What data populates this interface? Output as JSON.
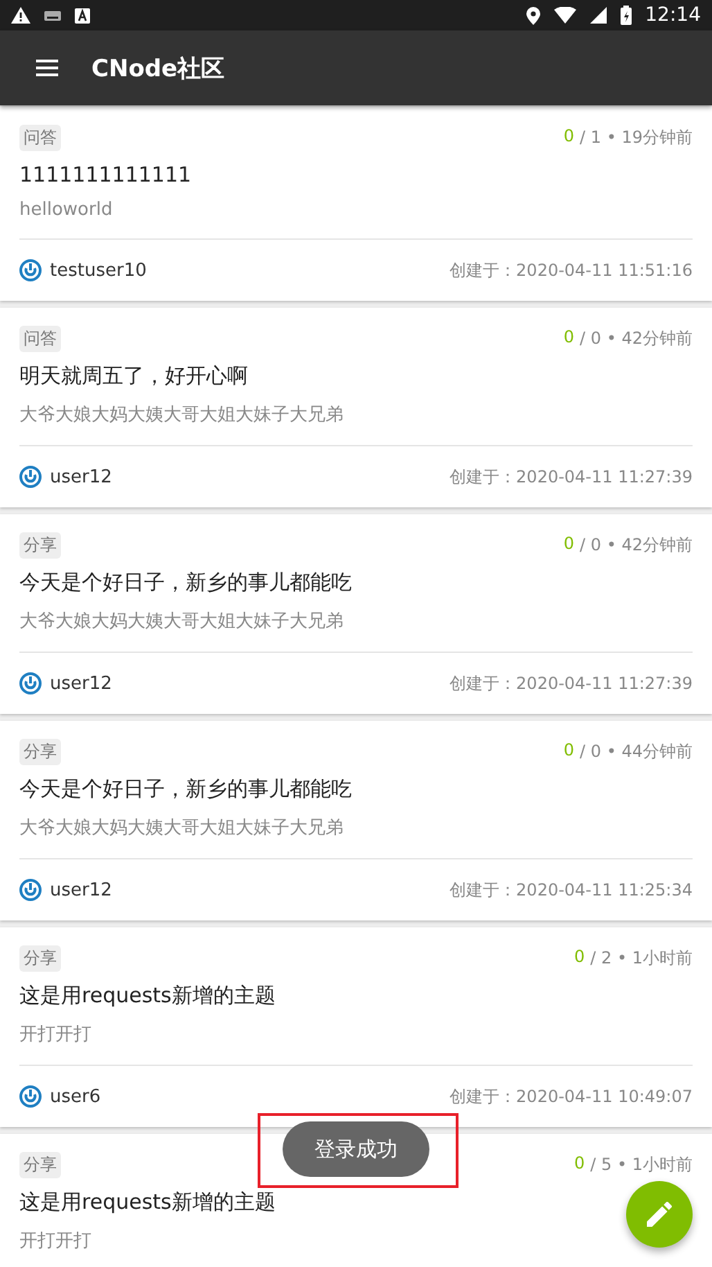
{
  "status_bar": {
    "time": "12:14"
  },
  "app_bar": {
    "title": "CNode社区"
  },
  "topics": [
    {
      "tab": "问答",
      "like_count": "0",
      "stats": "/ 1 • 19分钟前",
      "title": "1111111111111",
      "excerpt": "helloworld",
      "author": "testuser10",
      "created": "创建于：2020-04-11 11:51:16"
    },
    {
      "tab": "问答",
      "like_count": "0",
      "stats": "/ 0 • 42分钟前",
      "title": "明天就周五了，好开心啊",
      "excerpt": "大爷大娘大妈大姨大哥大姐大妹子大兄弟",
      "author": "user12",
      "created": "创建于：2020-04-11 11:27:39"
    },
    {
      "tab": "分享",
      "like_count": "0",
      "stats": "/ 0 • 42分钟前",
      "title": "今天是个好日子，新乡的事儿都能吃",
      "excerpt": "大爷大娘大妈大姨大哥大姐大妹子大兄弟",
      "author": "user12",
      "created": "创建于：2020-04-11 11:27:39"
    },
    {
      "tab": "分享",
      "like_count": "0",
      "stats": "/ 0 • 44分钟前",
      "title": "今天是个好日子，新乡的事儿都能吃",
      "excerpt": "大爷大娘大妈大姨大哥大姐大妹子大兄弟",
      "author": "user12",
      "created": "创建于：2020-04-11 11:25:34"
    },
    {
      "tab": "分享",
      "like_count": "0",
      "stats": "/ 2 • 1小时前",
      "title": "这是用requests新增的主题",
      "excerpt": "开打开打",
      "author": "user6",
      "created": "创建于：2020-04-11 10:49:07"
    },
    {
      "tab": "分享",
      "like_count": "0",
      "stats": "/ 5 • 1小时前",
      "title": "这是用requests新增的主题",
      "excerpt": "开打开打"
    }
  ],
  "toast": {
    "text": "登录成功"
  }
}
